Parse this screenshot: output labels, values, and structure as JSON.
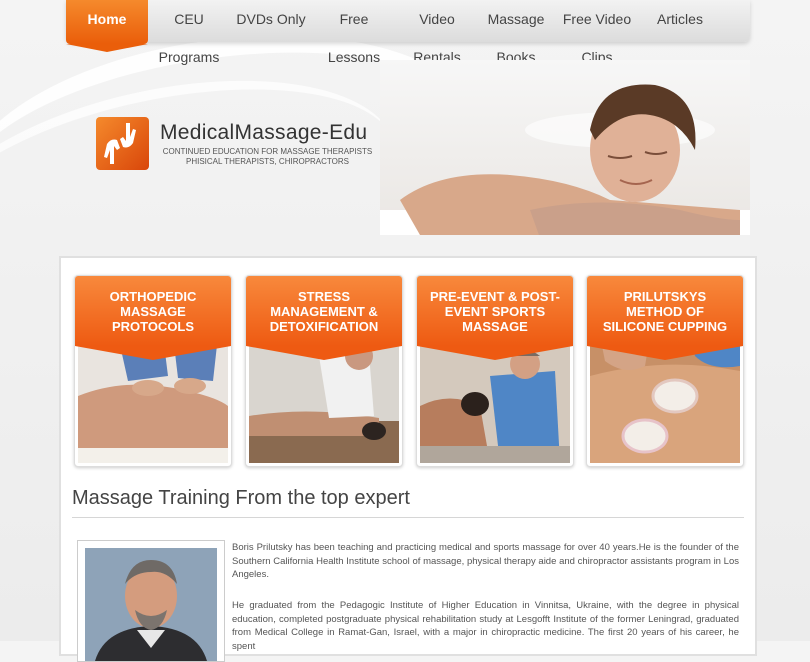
{
  "nav": {
    "home": "Home",
    "items": [
      "CEU Programs",
      "DVDs Only",
      "Free Lessons",
      "Video Rentals",
      "Massage Books",
      "Free Video Clips",
      "Articles"
    ]
  },
  "logo": {
    "title": "MedicalMassage-Edu",
    "subtitle_line1": "CONTINUED EDUCATION FOR MASSAGE THERAPISTS",
    "subtitle_line2": "PHISICAL THERAPISTS, CHIROPRACTORS"
  },
  "cards": [
    {
      "title": "ORTHOPEDIC MASSAGE PROTOCOLS"
    },
    {
      "title": "STRESS MANAGEMENT & DETOXIFICATION"
    },
    {
      "title": "PRE-EVENT & POST- EVENT SPORTS MASSAGE"
    },
    {
      "title": "PRILUTSKYS METHOD OF SILICONE CUPPING"
    }
  ],
  "section": {
    "title": "Massage Training From the top expert",
    "para1": "Boris Prilutsky has been teaching and practicing medical and sports massage for over 40 years.He is the founder of the Southern California Health Institute school of massage, physical therapy aide and chiropractor assistants program in Los Angeles.",
    "para2": "He graduated from the Pedagogic Institute of Higher Education in Vinnitsa, Ukraine, with the degree in physical education, completed postgraduate physical rehabilitation study at Lesgofft Institute of the former Leningrad, graduated from Medical College in Ramat-Gan, Israel, with a major in chiropractic medicine. The first 20 years of his career, he spent"
  },
  "colors": {
    "accent": "#ee5a12",
    "text": "#555555"
  }
}
